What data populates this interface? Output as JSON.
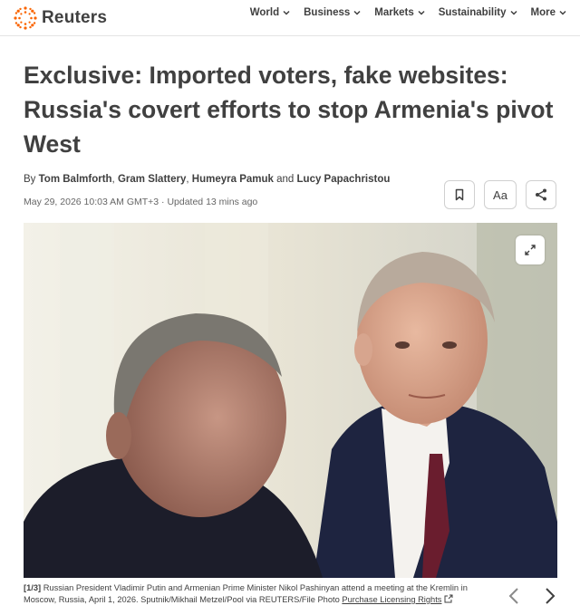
{
  "header": {
    "brand": "Reuters",
    "nav": [
      {
        "label": "World"
      },
      {
        "label": "Business"
      },
      {
        "label": "Markets"
      },
      {
        "label": "Sustainability"
      },
      {
        "label": "More"
      }
    ]
  },
  "article": {
    "headline": "Exclusive: Imported voters, fake websites: Russia's covert efforts to stop Armenia's pivot West",
    "byline_prefix": "By",
    "authors": [
      "Tom Balmforth",
      "Gram Slattery",
      "Humeyra Pamuk",
      "Lucy Papachristou"
    ],
    "byline_and": "and",
    "dateline": "May 29, 2026 10:03 AM GMT+3 · Updated 13 mins ago",
    "tools": {
      "bookmark_icon": "bookmark-icon",
      "text_size_label": "Aa",
      "share_icon": "share-icon"
    }
  },
  "photo": {
    "counter": "[1/3]",
    "caption": "Russian President Vladimir Putin and Armenian Prime Minister Nikol Pashinyan attend a meeting at the Kremlin in Moscow, Russia, April 1, 2026. Sputnik/Mikhail Metzel/Pool via REUTERS/File Photo",
    "licensing_link": "Purchase Licensing Rights"
  },
  "colors": {
    "brand_orange": "#fa6400",
    "text": "#404040"
  }
}
